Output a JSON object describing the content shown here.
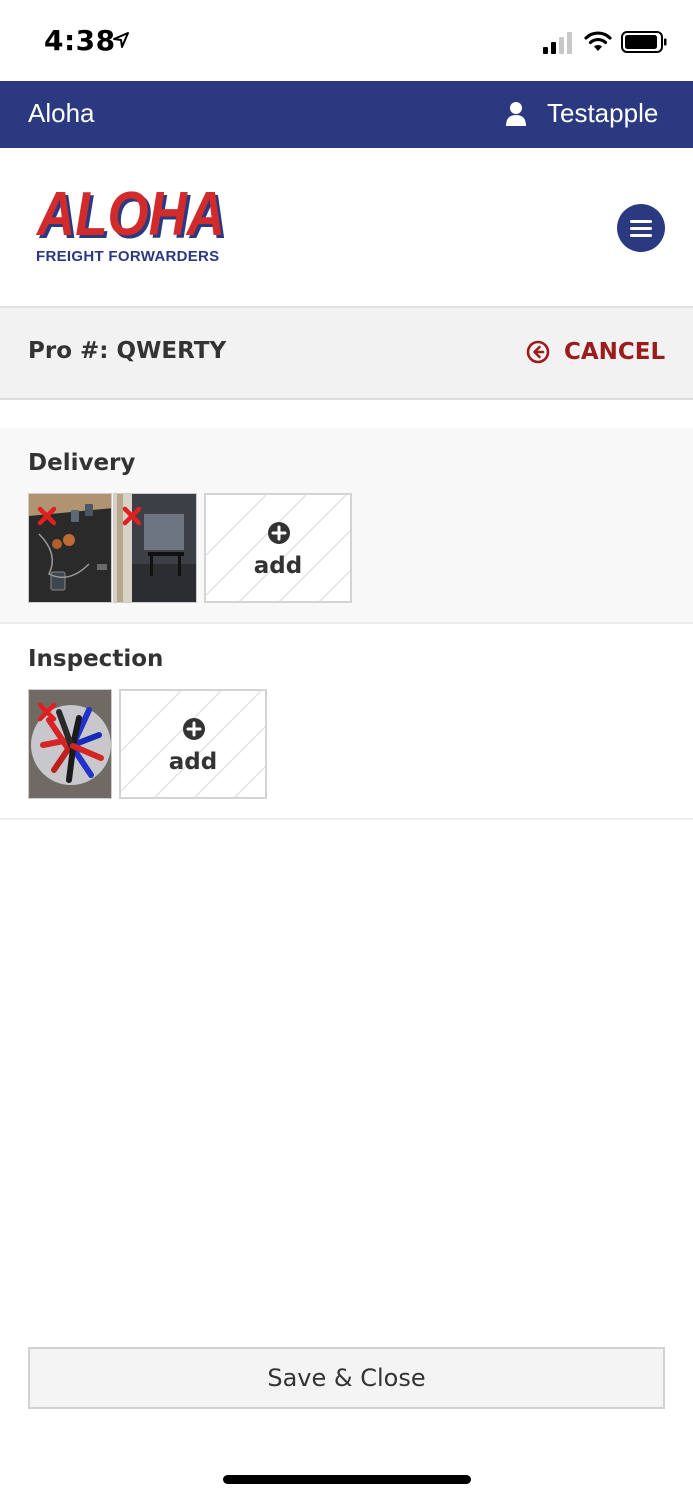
{
  "status_bar": {
    "time": "4:38"
  },
  "top_nav": {
    "brand": "Aloha",
    "user_name": "Testapple"
  },
  "logo": {
    "word": "ALOHA",
    "subtitle": "FREIGHT FORWARDERS"
  },
  "pro_bar": {
    "label": "Pro #: QWERTY",
    "cancel_label": "CANCEL"
  },
  "sections": [
    {
      "title": "Delivery",
      "photo_count": 2,
      "add_label": "add"
    },
    {
      "title": "Inspection",
      "photo_count": 1,
      "add_label": "add"
    }
  ],
  "save_button": {
    "label": "Save & Close"
  },
  "colors": {
    "nav": "#2b3a80",
    "cancel": "#9b1c1c",
    "logo_red": "#d22b2b"
  }
}
